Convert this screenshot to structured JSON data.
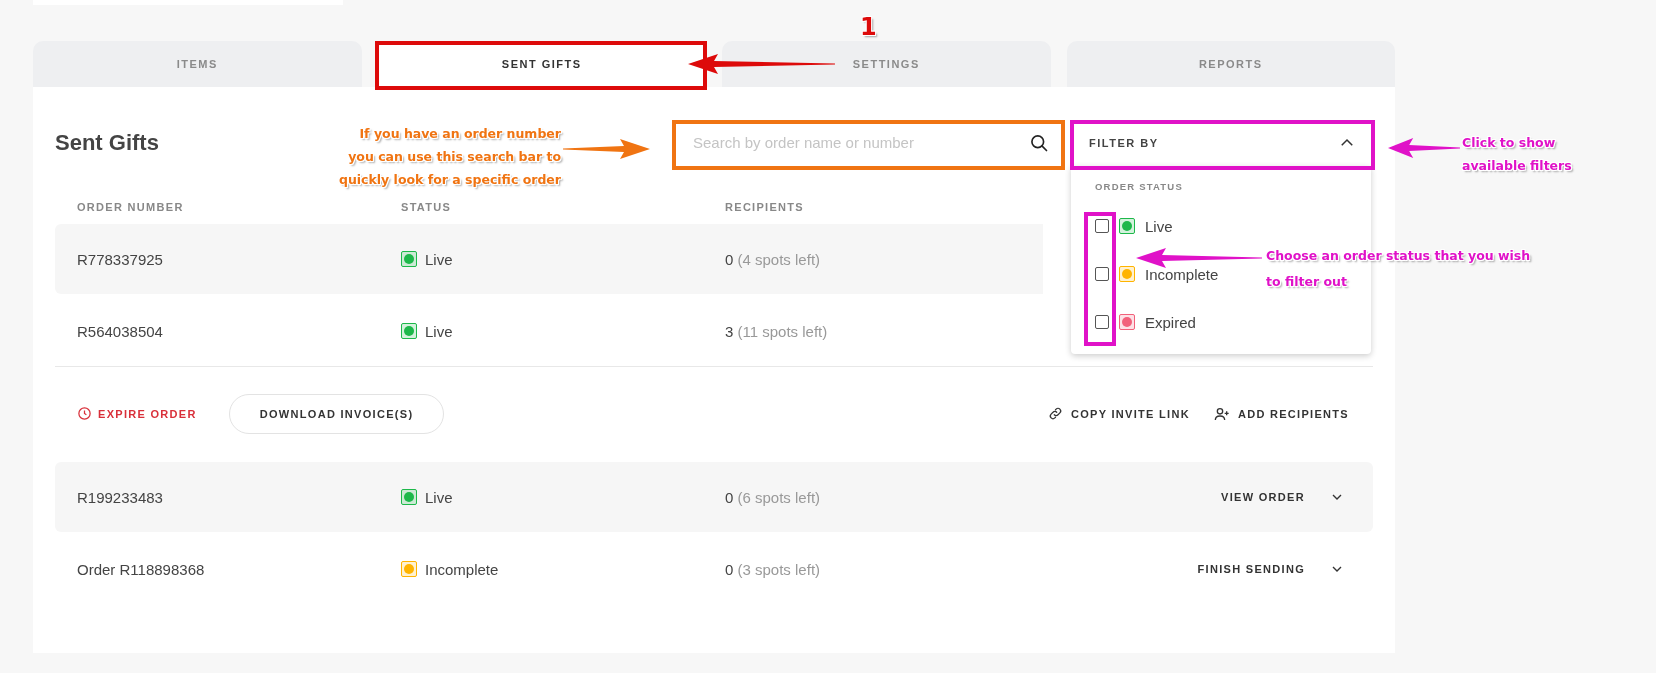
{
  "tabs": [
    {
      "label": "ITEMS",
      "selected": false
    },
    {
      "label": "SENT GIFTS",
      "selected": true
    },
    {
      "label": "SETTINGS",
      "selected": false
    },
    {
      "label": "REPORTS",
      "selected": false
    }
  ],
  "page_title": "Sent Gifts",
  "search": {
    "placeholder": "Search by order name or number"
  },
  "filter": {
    "label": "FILTER BY",
    "expanded": true,
    "section": "ORDER STATUS",
    "options": [
      {
        "label": "Live",
        "color": "#1db84a",
        "checked": false
      },
      {
        "label": "Incomplete",
        "color": "#ffb400",
        "checked": false
      },
      {
        "label": "Expired",
        "color": "#f2607a",
        "checked": false
      }
    ]
  },
  "table": {
    "columns": [
      "ORDER NUMBER",
      "STATUS",
      "RECIPIENTS"
    ],
    "rows": [
      {
        "order": "R778337925",
        "status": "Live",
        "color": "#1db84a",
        "count": "0",
        "spots": "(4 spots left)",
        "expanded": false
      },
      {
        "order": "R564038504",
        "status": "Live",
        "color": "#1db84a",
        "count": "3",
        "spots": "(11 spots left)",
        "expanded": true,
        "actions": {
          "expire": "EXPIRE ORDER",
          "download": "DOWNLOAD INVOICE(S)",
          "copy_link": "COPY INVITE LINK",
          "add_recipients": "ADD RECIPIENTS"
        }
      },
      {
        "order": "R199233483",
        "status": "Live",
        "color": "#1db84a",
        "count": "0",
        "spots": "(6 spots left)",
        "expanded": false,
        "action": "VIEW ORDER"
      },
      {
        "order": "Order R118898368",
        "status": "Incomplete",
        "color": "#ffb400",
        "count": "0",
        "spots": "(3 spots left)",
        "expanded": false,
        "action": "FINISH SENDING"
      }
    ]
  },
  "annotations": [
    {
      "kind": "number",
      "text": "1",
      "color": "#dd0a0a"
    },
    {
      "kind": "note",
      "text": "If you have an order number you can use this search bar to quickly look for a specific order",
      "color": "#f07412"
    },
    {
      "kind": "note",
      "text": "Click to show available filters",
      "color": "#e012c8"
    },
    {
      "kind": "note",
      "text": "Choose an order status that you wish to filter out",
      "color": "#e012c8"
    }
  ]
}
